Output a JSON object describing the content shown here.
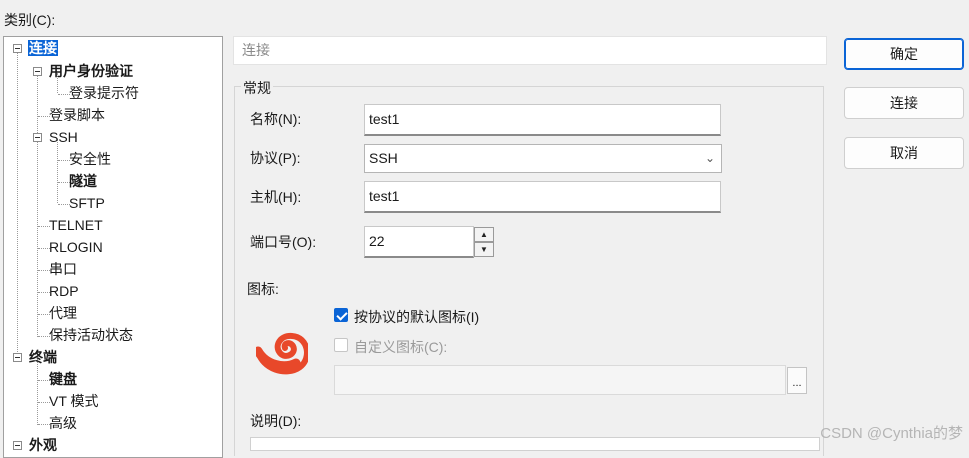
{
  "category_label": "类别(C):",
  "tree": {
    "conn": "连接",
    "auth": "用户身份验证",
    "login_prompt": "登录提示符",
    "login_script": "登录脚本",
    "ssh": "SSH",
    "security": "安全性",
    "tunnel": "隧道",
    "sftp": "SFTP",
    "telnet": "TELNET",
    "rlogin": "RLOGIN",
    "serial": "串口",
    "rdp": "RDP",
    "proxy": "代理",
    "keepalive": "保持活动状态",
    "terminal": "终端",
    "keyboard": "键盘",
    "vt": "VT 模式",
    "advanced": "高级",
    "appearance": "外观"
  },
  "section_title": "连接",
  "group_title": "常规",
  "form": {
    "name_label": "名称(N):",
    "name_value": "test1",
    "protocol_label": "协议(P):",
    "protocol_value": "SSH",
    "host_label": "主机(H):",
    "host_value": "test1",
    "port_label": "端口号(O):",
    "port_value": "22",
    "icon_label": "图标:",
    "default_icon_label": "按协议的默认图标(I)",
    "default_icon_checked": true,
    "custom_icon_label": "自定义图标(C):",
    "custom_icon_checked": false,
    "custom_icon_path": "",
    "browse_label": "...",
    "desc_label": "说明(D):"
  },
  "buttons": {
    "ok": "确定",
    "connect": "连接",
    "cancel": "取消"
  },
  "icon": {
    "name": "ssh-swirl-icon",
    "color": "#e8482a"
  },
  "watermark": "CSDN @Cynthia的梦"
}
